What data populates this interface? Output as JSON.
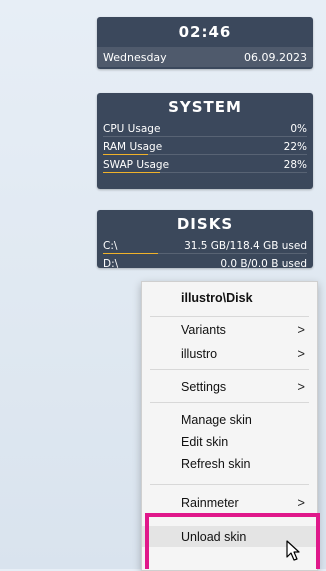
{
  "clock": {
    "time": "02:46",
    "day": "Wednesday",
    "date": "06.09.2023"
  },
  "system": {
    "title": "SYSTEM",
    "rows": [
      {
        "label": "CPU Usage",
        "value": "0%",
        "usage": 0
      },
      {
        "label": "RAM Usage",
        "value": "22%",
        "usage": 0.22
      },
      {
        "label": "SWAP Usage",
        "value": "28%",
        "usage": 0.28
      }
    ]
  },
  "disks": {
    "title": "DISKS",
    "rows": [
      {
        "label": "C:\\",
        "value": "31.5 GB/118.4 GB used",
        "usage": 0.27
      },
      {
        "label": "D:\\",
        "value": "0.0 B/0.0 B used",
        "usage": 0
      }
    ]
  },
  "context_menu": {
    "header": "illustro\\Disk",
    "items": {
      "variants": "Variants",
      "illustro": "illustro",
      "settings": "Settings",
      "manage_skin": "Manage skin",
      "edit_skin": "Edit skin",
      "refresh_skin": "Refresh skin",
      "rainmeter": "Rainmeter",
      "unload_skin": "Unload skin"
    },
    "submenu_arrow": ">"
  },
  "highlight_color": "#e0188a",
  "accent_color": "#f0b22a",
  "icons": [
    "mouse-pointer-icon"
  ]
}
